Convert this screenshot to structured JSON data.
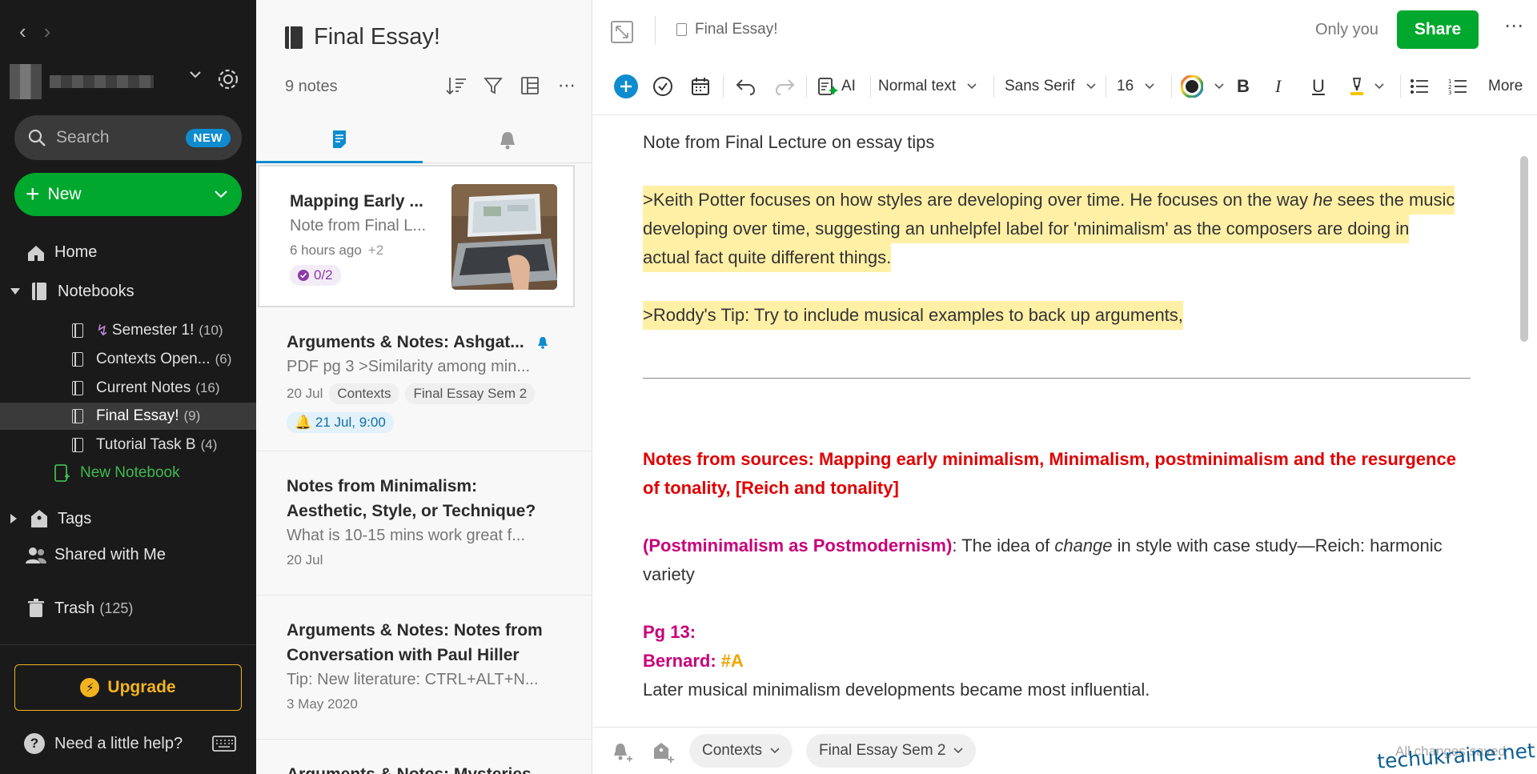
{
  "sidebar": {
    "search_label": "Search",
    "search_badge": "NEW",
    "new_label": "New",
    "home_label": "Home",
    "notebooks_label": "Notebooks",
    "notebooks": [
      {
        "label": "Semester 1!",
        "count": "(10)"
      },
      {
        "label": "Contexts Open...",
        "count": "(6)"
      },
      {
        "label": "Current Notes",
        "count": "(16)"
      },
      {
        "label": "Final Essay!",
        "count": "(9)"
      },
      {
        "label": "Tutorial Task B",
        "count": "(4)"
      }
    ],
    "new_notebook_label": "New Notebook",
    "tags_label": "Tags",
    "shared_label": "Shared with Me",
    "trash_label": "Trash",
    "trash_count": "(125)",
    "upgrade_label": "Upgrade",
    "help_label": "Need a little help?"
  },
  "notelist": {
    "title": "Final Essay!",
    "count_label": "9 notes",
    "notes": [
      {
        "title": "Mapping Early ...",
        "snippet": "Note from Final L...",
        "date": "6 hours ago",
        "extra": "+2",
        "task": "0/2"
      },
      {
        "title": "Arguments & Notes: Ashgat...",
        "snippet": "PDF pg 3 >Similarity among min...",
        "date": "20 Jul",
        "tag1": "Contexts",
        "tag2": "Final Essay Sem 2",
        "reminder": "21 Jul, 9:00"
      },
      {
        "title_line1": "Notes from Minimalism:",
        "title_line2": "Aesthetic, Style, or Technique?",
        "snippet": "What is 10-15 mins work great f...",
        "date": "20 Jul"
      },
      {
        "title_line1": "Arguments & Notes: Notes from",
        "title_line2": "Conversation with Paul Hiller",
        "snippet": "Tip: New literature: CTRL+ALT+N...",
        "date": "3 May 2020"
      },
      {
        "title": "Arguments & Notes: Mysteries..."
      }
    ]
  },
  "editor": {
    "breadcrumb": "Final Essay!",
    "share_scope": "Only you",
    "share_label": "Share",
    "toolbar": {
      "ai_label": "AI",
      "style_label": "Normal text",
      "font_label": "Sans Serif",
      "size_label": "16",
      "more_label": "More"
    },
    "body": {
      "p1": "Note from Final Lecture on essay tips",
      "p2a_1": ">Keith Potter focuses on how styles are developing over time. He focuses on the way ",
      "p2a_em": "he",
      "p2a_2": " sees the music",
      "p2b": "developing over time, suggesting an unhelpfel label for 'minimalism' as the composers are doing in",
      "p2c": "actual fact quite different things.",
      "p3": ">Roddy's Tip: Try to include musical examples to back up arguments,",
      "p4a": "Notes from sources: Mapping early minimalism, Minimalism, postminimalism and the resurgence",
      "p4b": "of tonality, [Reich and tonality]",
      "p5_head": "(Postminimalism as Postmodernism)",
      "p5_1": ": The idea of ",
      "p5_em": "change",
      "p5_2": " in style with case study—Reich: harmonic",
      "p5b": "variety",
      "p6": "Pg 13:",
      "p7_name": "Bernard: ",
      "p7_tag": "#A",
      "p8": "Later musical minimalism developments became most influential."
    },
    "footer": {
      "tag1": "Contexts",
      "tag2": "Final Essay Sem 2",
      "status": "All changes saved"
    }
  },
  "watermark": "techukraine.net",
  "colors": {
    "accent_green": "#00a82d",
    "accent_blue": "#0e8ccf",
    "highlight": "#fff0a6",
    "red_text": "#e00000",
    "magenta_text": "#c8007a",
    "upgrade_gold": "#f2b31e"
  }
}
